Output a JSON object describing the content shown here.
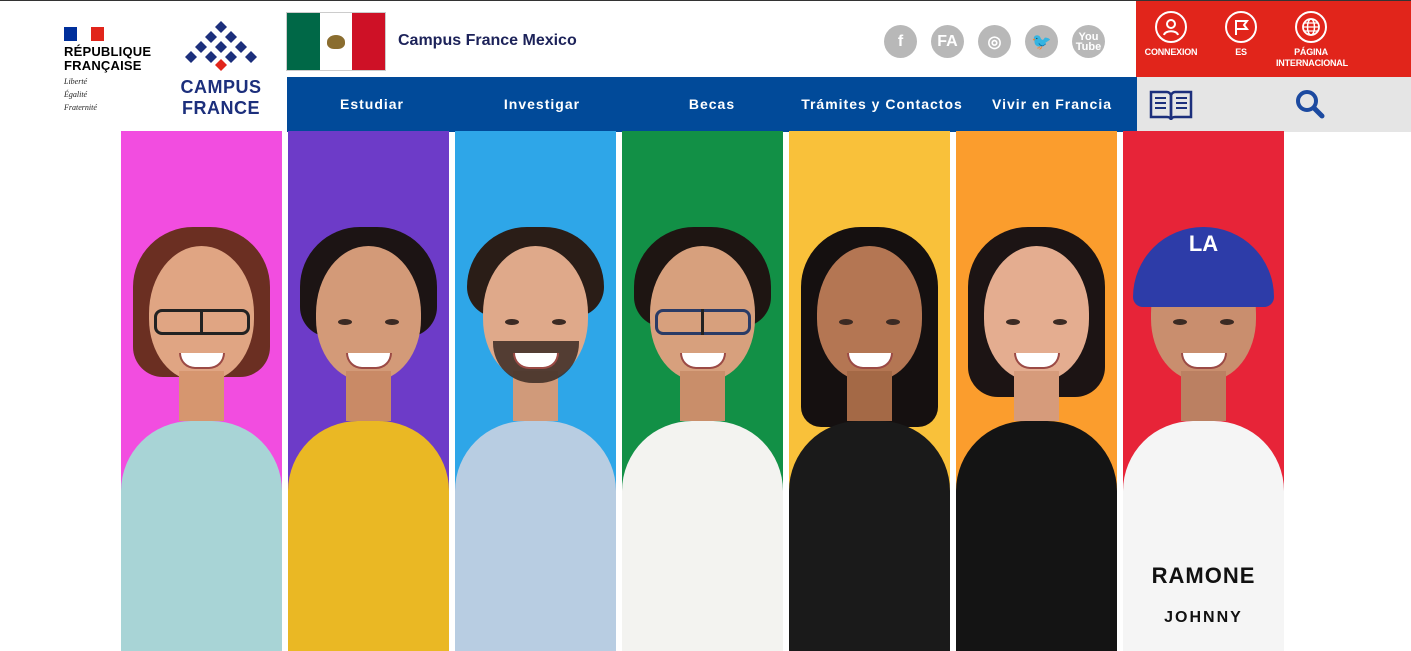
{
  "header": {
    "republique": {
      "name_line1": "RÉPUBLIQUE",
      "name_line2": "FRANÇAISE",
      "motto_1": "Liberté",
      "motto_2": "Égalité",
      "motto_3": "Fraternité"
    },
    "campus_logo": {
      "line1": "CAMPUS",
      "line2": "FRANCE"
    },
    "site_title": "Campus France Mexico",
    "social": [
      {
        "icon": "facebook-icon",
        "label": "f"
      },
      {
        "icon": "fa-icon",
        "label": "FA"
      },
      {
        "icon": "instagram-icon",
        "label": "◎"
      },
      {
        "icon": "twitter-icon",
        "label": "🐦"
      },
      {
        "icon": "youtube-icon",
        "label": "You Tube"
      }
    ],
    "top_right": [
      {
        "icon": "user-icon",
        "label": "CONNEXION"
      },
      {
        "icon": "flag-icon",
        "label": "ES"
      },
      {
        "icon": "globe-icon",
        "label": "PÁGINA INTERNACIONAL"
      }
    ]
  },
  "nav": [
    {
      "label": "Estudiar"
    },
    {
      "label": "Investigar"
    },
    {
      "label": "Becas"
    },
    {
      "label": "Trámites y Contactos"
    },
    {
      "label": "Vivir en Francia"
    }
  ],
  "hero": {
    "cap_text": "LA",
    "shirt_text": "RAMONE",
    "shirt_sub": "JOHNNY"
  },
  "colors": {
    "nav_blue": "#014a99",
    "accent_red": "#e1251b",
    "logo_navy": "#1c2f7c",
    "panel_colors": [
      "#f24de0",
      "#6d3bc8",
      "#2ea6e8",
      "#129046",
      "#f9c13a",
      "#fb9d2d",
      "#e72438"
    ]
  }
}
